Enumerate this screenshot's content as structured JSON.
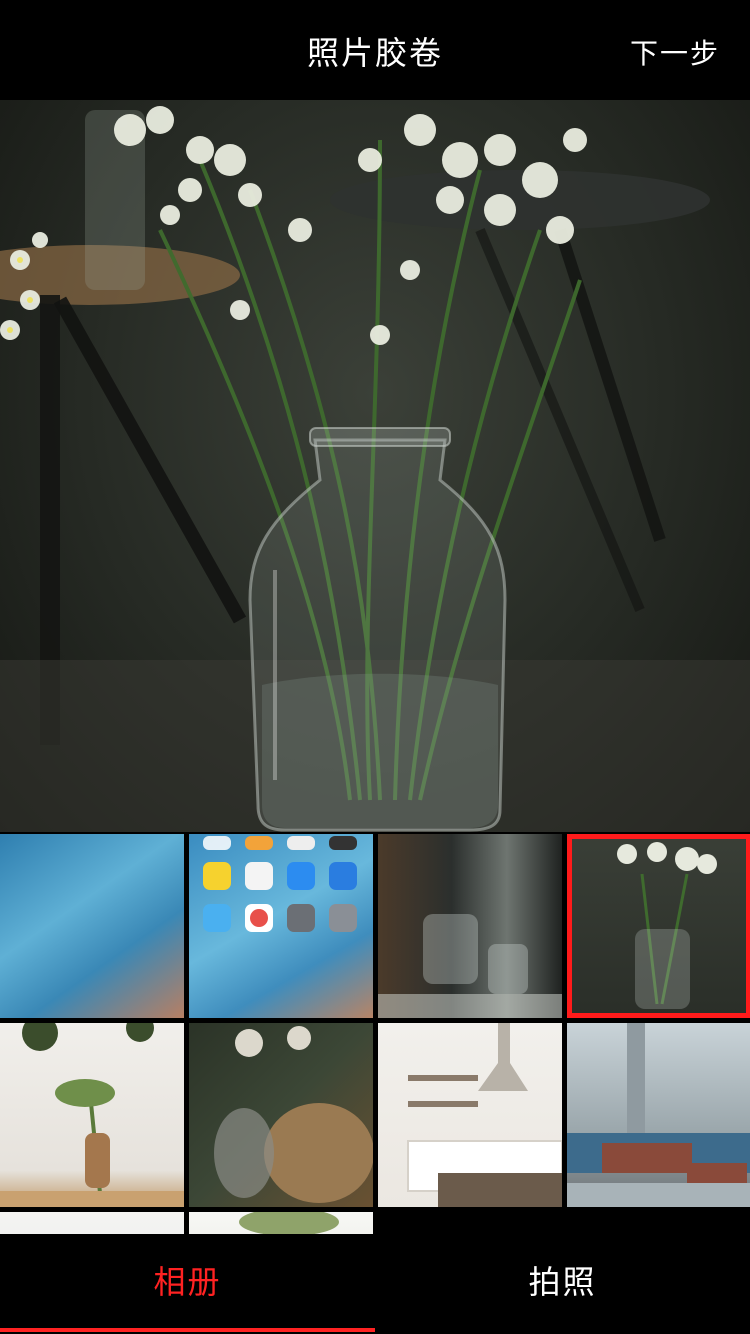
{
  "header": {
    "title": "照片胶卷",
    "next_label": "下一步"
  },
  "tabs": [
    {
      "label": "相册",
      "active": true
    },
    {
      "label": "拍照",
      "active": false
    }
  ],
  "colors": {
    "accent": "#ff2222",
    "background": "#000000"
  }
}
